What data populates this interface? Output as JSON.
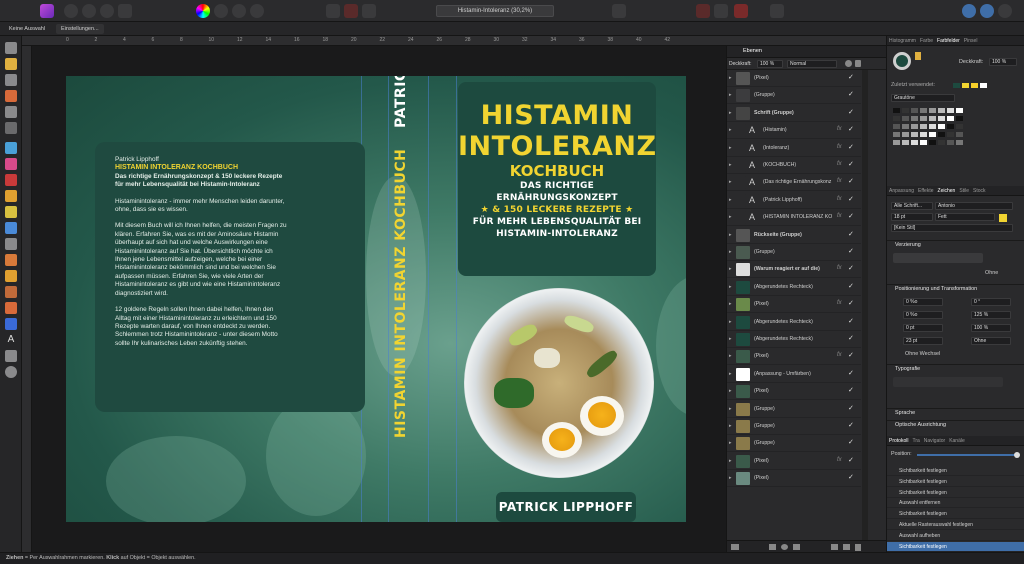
{
  "toolbar": {
    "document_title": "Histamin-Intoleranz (30,2%)"
  },
  "context": {
    "no_selection": "Keine Auswahl",
    "settings": "Einstellungen..."
  },
  "ruler": {
    "ticks": [
      "0",
      "2",
      "4",
      "6",
      "8",
      "10",
      "12",
      "14",
      "16",
      "18",
      "20",
      "22",
      "24",
      "26",
      "28",
      "30",
      "32",
      "34",
      "36",
      "38",
      "40",
      "42"
    ]
  },
  "cover": {
    "back": {
      "author": "Patrick Lipphoff",
      "title": "HISTAMIN INTOLERANZ KOCHBUCH",
      "subtitle1": "Das richtige Ernährungskonzept & 150 leckere Rezepte",
      "subtitle2": "für mehr Lebensqualität bei Histamin-Intoleranz",
      "p1_l1": "Histaminintoleranz - immer mehr Menschen leiden darunter,",
      "p1_l2": "ohne, dass sie es wissen.",
      "p2_l1": "Mit diesem Buch will ich Ihnen helfen, die meisten Fragen zu",
      "p2_l2": "klären. Erfahren Sie, was es mit der Aminosäure Histamin",
      "p2_l3": "überhaupt auf sich hat und welche Auswirkungen eine",
      "p2_l4": "Histaminintoleranz auf Sie hat. Übersichtlich möchte ich",
      "p2_l5": "Ihnen jene Lebensmittel aufzeigen, welche bei einer",
      "p2_l6": "Histaminintoleranz bekömmlich sind und bei welchen Sie",
      "p2_l7": "aufpassen müssen. Erfahren Sie, wie viele Arten der",
      "p2_l8": "Histaminintoleranz es gibt und wie eine Histaminintoleranz",
      "p2_l9": "diagnostiziert wird.",
      "p3_l1": "12 goldene Regeln sollen Ihnen dabei helfen, Ihnen den",
      "p3_l2": "Alltag mit einer Histaminintoleranz zu erleichtern und 150",
      "p3_l3": "Rezepte warten darauf, von Ihnen entdeckt zu werden.",
      "p3_l4": "Schlemmen trotz Histaminintoleranz - unter diesem Motto",
      "p3_l5": "sollte Ihr kulinarisches Leben zukünftig stehen."
    },
    "spine": {
      "title": "HISTAMIN INTOLERANZ KOCHBUCH",
      "author": "PATRICK LIPPHOFF"
    },
    "front": {
      "line1": "HISTAMIN",
      "line2": "INTOLERANZ",
      "line3": "KOCHBUCH",
      "line4": "DAS RICHTIGE ERNÄHRUNGSKONZEPT",
      "line5": "★ & 150 LECKERE REZEPTE ★",
      "line6": "FÜR MEHR LEBENSQUALITÄT BEI",
      "line7": "HISTAMIN-INTOLERANZ",
      "author": "PATRICK LIPPHOFF"
    }
  },
  "layers": {
    "tab": "Ebenen",
    "opacity_label": "Deckkraft:",
    "opacity_value": "100 %",
    "blend_mode": "Normal",
    "rows": [
      {
        "name": "(Pixel)",
        "fx": false
      },
      {
        "name": "(Gruppe)",
        "fx": false
      },
      {
        "name": "Schrift (Gruppe)",
        "fx": false
      },
      {
        "name": "(Histamin)",
        "fx": true
      },
      {
        "name": "(Intoleranz)",
        "fx": true
      },
      {
        "name": "(KOCHBUCH)",
        "fx": true
      },
      {
        "name": "(Das richtige Ernährungskonz",
        "fx": true
      },
      {
        "name": "(Patrick Lipphoff)",
        "fx": true
      },
      {
        "name": "(HISTAMIN INTOLERANZ KO",
        "fx": true
      },
      {
        "name": "Rückseite (Gruppe)",
        "fx": false
      },
      {
        "name": "(Gruppe)",
        "fx": false
      },
      {
        "name": "(Warum reagiert er auf die)",
        "fx": true
      },
      {
        "name": "(Abgerundetes Rechteck)",
        "fx": false
      },
      {
        "name": "(Pixel)",
        "fx": true
      },
      {
        "name": "(Abgerundetes Rechteck)",
        "fx": false
      },
      {
        "name": "(Abgerundetes Rechteck)",
        "fx": false
      },
      {
        "name": "(Pixel)",
        "fx": true
      },
      {
        "name": "(Anpassung - Umfärben)",
        "fx": false
      },
      {
        "name": "(Pixel)",
        "fx": false
      },
      {
        "name": "(Gruppe)",
        "fx": false
      },
      {
        "name": "(Gruppe)",
        "fx": false
      },
      {
        "name": "(Gruppe)",
        "fx": false
      },
      {
        "name": "(Pixel)",
        "fx": true
      },
      {
        "name": "(Pixel)",
        "fx": false
      }
    ],
    "check": "✓"
  },
  "right_panel": {
    "tabs1": [
      "Histogramm",
      "Farbe",
      "Farbfelder",
      "Pinsel"
    ],
    "opacity_label": "Deckkraft:",
    "opacity_value": "100 %",
    "recent_label": "Zuletzt verwendet:",
    "palette_name": "Grautöne",
    "tabs2": [
      "Anpassung",
      "Effekte",
      "Zeichen",
      "Stile",
      "Stock"
    ],
    "font_scope": "Alle Schrift...",
    "font_name": "Antonio",
    "font_size": "18 pt",
    "font_weight": "Fett",
    "style": "[Kein Stil]",
    "sec_decoration": "Verzierung",
    "none_label": "Ohne",
    "sec_position": "Positionierung und Transformation",
    "pos_v1": "0 %o",
    "pos_v2": "0 °",
    "pos_v3": "0 %o",
    "pos_v4": "125 %",
    "pos_v5": "0 pt",
    "pos_v6": "100 %",
    "pos_v7": "23 pt",
    "pos_v8": "Ohne",
    "no_change": "Ohne Wechsel",
    "sec_typo": "Typografie",
    "sec_language": "Sprache",
    "sec_optical": "Optische Ausrichtung",
    "tabs3": [
      "Protokoll",
      "Tra",
      "Navigator",
      "Kanäle"
    ],
    "position_label": "Position:",
    "history": [
      "Sichtbarkeit festlegen",
      "Sichtbarkeit festlegen",
      "Sichtbarkeit festlegen",
      "Auswahl entfernen",
      "Sichtbarkeit festlegen",
      "Aktuelle Rasterauswahl festlegen",
      "Auswahl aufheben",
      "Sichtbarkeit festlegen"
    ]
  },
  "status": {
    "drag_word": "Ziehen",
    "drag_text": " = Per Auswahlrahmen markieren. ",
    "click_word": "Klick",
    "click_text": " auf Objekt = Objekt auswählen."
  },
  "colors": {
    "accent": "#f1d431",
    "cover_dark": "#1d4a3f",
    "selection": "#3f6ea8"
  }
}
